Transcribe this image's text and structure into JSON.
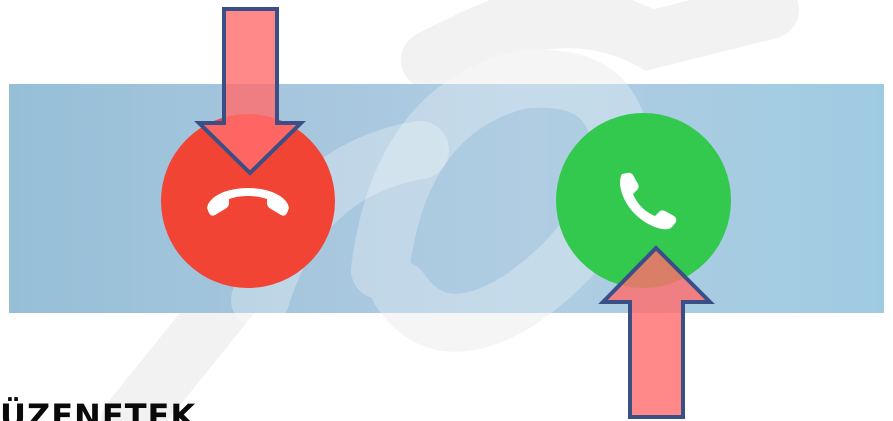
{
  "call_screen": {
    "decline_button": {
      "icon": "phone-hangup-icon",
      "color": "#f14435"
    },
    "accept_button": {
      "icon": "phone-icon",
      "color": "#33c94f"
    }
  },
  "annotations": {
    "arrow_color": "#ff7f7f",
    "arrow_outline": "#3a4f86",
    "watermark_color": "#f2f2f2"
  },
  "section": {
    "heading": "ÜZENETEK"
  }
}
